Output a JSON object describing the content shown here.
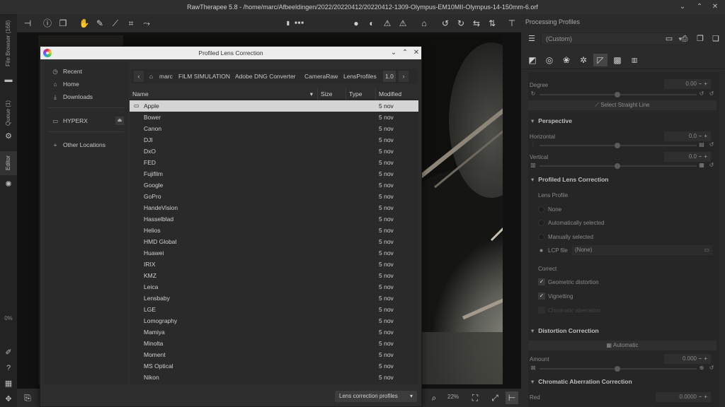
{
  "window": {
    "title": "RawTherapee 5.8 - /home/marc/Afbeeldingen/2022/20220412/20220412-1309-Olympus-EM10MII-Olympus-14-150mm-6.orf"
  },
  "left_tabs": {
    "file_browser": "File Browser (168)",
    "queue": "Queue (1)",
    "editor": "Editor",
    "progress": "0%"
  },
  "bottom": {
    "zoom": "22%"
  },
  "right_panel": {
    "processing_profiles_title": "Processing Profiles",
    "profile_value": "(Custom)",
    "rotate": {
      "degree_label": "Degree",
      "degree_value": "0.00",
      "select_straight_line": "Select Straight Line"
    },
    "perspective": {
      "title": "Perspective",
      "horizontal_label": "Horizontal",
      "horizontal_value": "0.0",
      "vertical_label": "Vertical",
      "vertical_value": "0.0"
    },
    "lens_correction": {
      "title": "Profiled Lens Correction",
      "lens_profile_label": "Lens Profile",
      "options": [
        "None",
        "Automatically selected",
        "Manually selected"
      ],
      "lcp_label": "LCP file",
      "lcp_value": "(None)",
      "correct_label": "Correct",
      "geometric": "Geometric distortion",
      "vignetting": "Vignetting",
      "chromatic": "Chromatic aberration"
    },
    "distortion": {
      "title": "Distortion Correction",
      "auto_button": "Automatic",
      "amount_label": "Amount",
      "amount_value": "0.000"
    },
    "chromatic": {
      "title": "Chromatic Aberration Correction",
      "red_label": "Red",
      "red_value": "0.0000"
    }
  },
  "dialog": {
    "title": "Profiled Lens Correction",
    "places": [
      {
        "icon": "clock-icon",
        "glyph": "◷",
        "label": "Recent"
      },
      {
        "icon": "home-icon",
        "glyph": "⌂",
        "label": "Home"
      },
      {
        "icon": "download-icon",
        "glyph": "⤓",
        "label": "Downloads"
      },
      {
        "icon": "drive-icon",
        "glyph": "▭",
        "label": "HYPERX"
      },
      {
        "icon": "plus-icon",
        "glyph": "+",
        "label": "Other Locations"
      }
    ],
    "path": [
      "marc",
      "FILM SIMULATION",
      "Adobe DNG Converter",
      "CameraRaw",
      "LensProfiles",
      "1.0"
    ],
    "columns": {
      "name": "Name",
      "size": "Size",
      "type": "Type",
      "modified": "Modified"
    },
    "files": [
      {
        "name": "Apple",
        "modified": "5 nov"
      },
      {
        "name": "Bower",
        "modified": "5 nov"
      },
      {
        "name": "Canon",
        "modified": "5 nov"
      },
      {
        "name": "DJI",
        "modified": "5 nov"
      },
      {
        "name": "DxO",
        "modified": "5 nov"
      },
      {
        "name": "FED",
        "modified": "5 nov"
      },
      {
        "name": "Fujifilm",
        "modified": "5 nov"
      },
      {
        "name": "Google",
        "modified": "5 nov"
      },
      {
        "name": "GoPro",
        "modified": "5 nov"
      },
      {
        "name": "HandeVision",
        "modified": "5 nov"
      },
      {
        "name": "Hasselblad",
        "modified": "5 nov"
      },
      {
        "name": "Helios",
        "modified": "5 nov"
      },
      {
        "name": "HMD Global",
        "modified": "5 nov"
      },
      {
        "name": "Huawei",
        "modified": "5 nov"
      },
      {
        "name": "IRIX",
        "modified": "5 nov"
      },
      {
        "name": "KMZ",
        "modified": "5 nov"
      },
      {
        "name": "Leica",
        "modified": "5 nov"
      },
      {
        "name": "Lensbaby",
        "modified": "5 nov"
      },
      {
        "name": "LGE",
        "modified": "5 nov"
      },
      {
        "name": "Lomography",
        "modified": "5 nov"
      },
      {
        "name": "Mamiya",
        "modified": "5 nov"
      },
      {
        "name": "Minolta",
        "modified": "5 nov"
      },
      {
        "name": "Moment",
        "modified": "5 nov"
      },
      {
        "name": "MS Optical",
        "modified": "5 nov"
      },
      {
        "name": "Nikon",
        "modified": "5 nov"
      }
    ],
    "filter_label": "Lens correction profiles"
  }
}
